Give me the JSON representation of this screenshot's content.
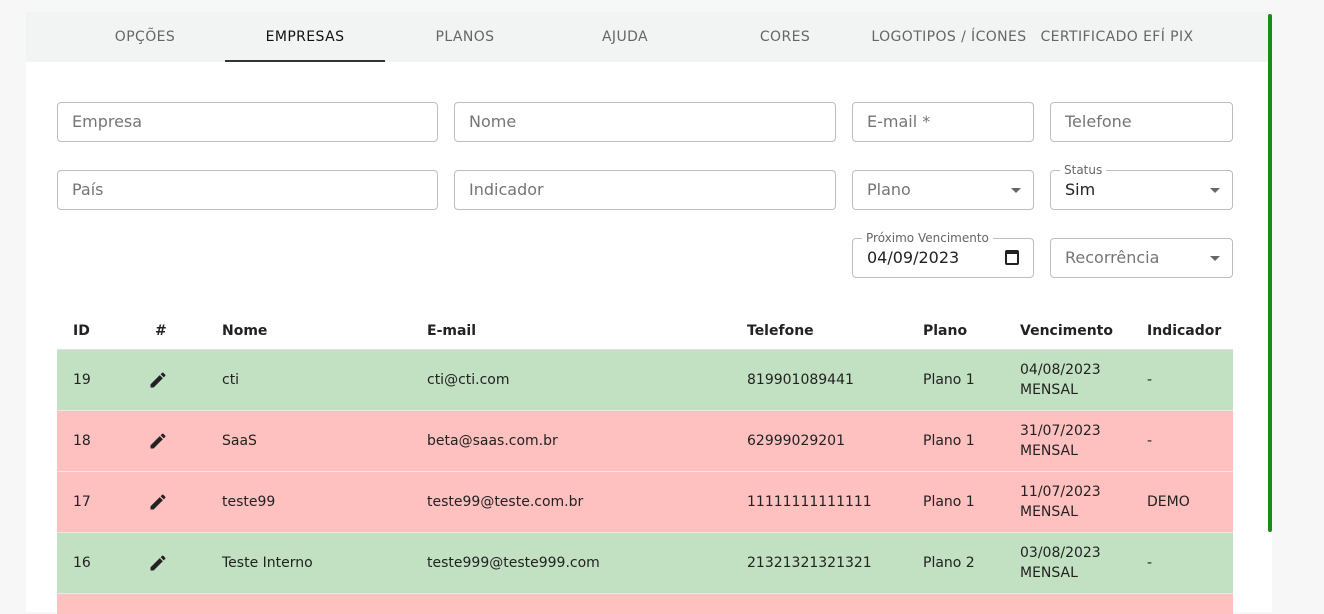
{
  "tabs": [
    {
      "label": "OPÇÕES"
    },
    {
      "label": "EMPRESAS"
    },
    {
      "label": "PLANOS"
    },
    {
      "label": "AJUDA"
    },
    {
      "label": "CORES"
    },
    {
      "label": "LOGOTIPOS / ÍCONES"
    },
    {
      "label": "CERTIFICADO EFÍ PIX"
    }
  ],
  "form": {
    "empresa_placeholder": "Empresa",
    "nome_placeholder": "Nome",
    "email_placeholder": "E-mail *",
    "telefone_placeholder": "Telefone",
    "pais_placeholder": "País",
    "indicador_placeholder": "Indicador",
    "plano_placeholder": "Plano",
    "status_label": "Status",
    "status_value": "Sim",
    "vencimento_label": "Próximo Vencimento",
    "vencimento_value": "04/09/2023",
    "recorrencia_placeholder": "Recorrência"
  },
  "table": {
    "headers": {
      "id": "ID",
      "edit": "#",
      "nome": "Nome",
      "email": "E-mail",
      "telefone": "Telefone",
      "plano": "Plano",
      "vencimento": "Vencimento",
      "indicador": "Indicador"
    },
    "rows": [
      {
        "id": "19",
        "nome": "cti",
        "email": "cti@cti.com",
        "telefone": "819901089441",
        "plano": "Plano 1",
        "vencimento_date": "04/08/2023",
        "vencimento_type": "MENSAL",
        "indicador": "-"
      },
      {
        "id": "18",
        "nome": "SaaS",
        "email": "beta@saas.com.br",
        "telefone": "62999029201",
        "plano": "Plano 1",
        "vencimento_date": "31/07/2023",
        "vencimento_type": "MENSAL",
        "indicador": "-"
      },
      {
        "id": "17",
        "nome": "teste99",
        "email": "teste99@teste.com.br",
        "telefone": "11111111111111",
        "plano": "Plano 1",
        "vencimento_date": "11/07/2023",
        "vencimento_type": "MENSAL",
        "indicador": "DEMO"
      },
      {
        "id": "16",
        "nome": "Teste Interno",
        "email": "teste999@teste999.com",
        "telefone": "21321321321321",
        "plano": "Plano 2",
        "vencimento_date": "03/08/2023",
        "vencimento_type": "MENSAL",
        "indicador": "-"
      }
    ]
  },
  "colors": {
    "row_active": "#c2e0c2",
    "row_expired": "#ffc0c0",
    "scroll_accent": "#1b8a1b"
  },
  "icons": {
    "edit": "pencil-icon",
    "select": "caret-down-icon",
    "date": "calendar-icon"
  }
}
